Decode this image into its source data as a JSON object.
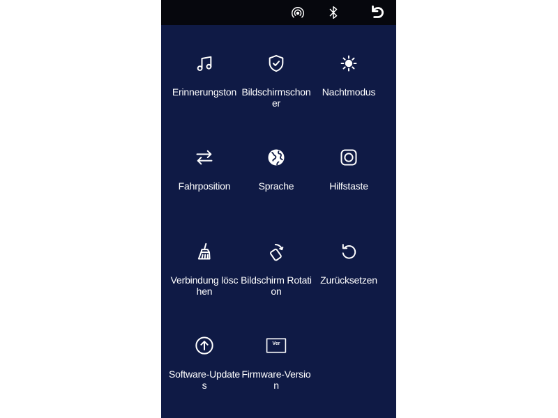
{
  "topbar": {
    "icons": [
      "hotspot-icon",
      "bluetooth-icon",
      "back-icon"
    ]
  },
  "menu": {
    "items": [
      {
        "label": "Erinnerungston",
        "icon": "music-note-icon"
      },
      {
        "label": "Bildschirmschoner",
        "icon": "shield-check-icon"
      },
      {
        "label": "Nachtmodus",
        "icon": "sun-icon"
      },
      {
        "label": "Fahrposition",
        "icon": "arrows-swap-icon"
      },
      {
        "label": "Sprache",
        "icon": "globe-icon"
      },
      {
        "label": "Hilfstaste",
        "icon": "rounded-square-icon"
      },
      {
        "label": "Verbindung löschen",
        "icon": "broom-icon"
      },
      {
        "label": "Bildschirm Rotation",
        "icon": "rotate-phone-icon"
      },
      {
        "label": "Zurücksetzen",
        "icon": "reset-icon"
      },
      {
        "label": "Software-Updates",
        "icon": "upload-circle-icon"
      },
      {
        "label": "Firmware-Version",
        "icon": "version-badge-icon"
      }
    ],
    "version_badge_text": "Ver"
  },
  "colors": {
    "background": "#0f1a45",
    "topbar": "#06070d",
    "text": "#ffffff"
  }
}
